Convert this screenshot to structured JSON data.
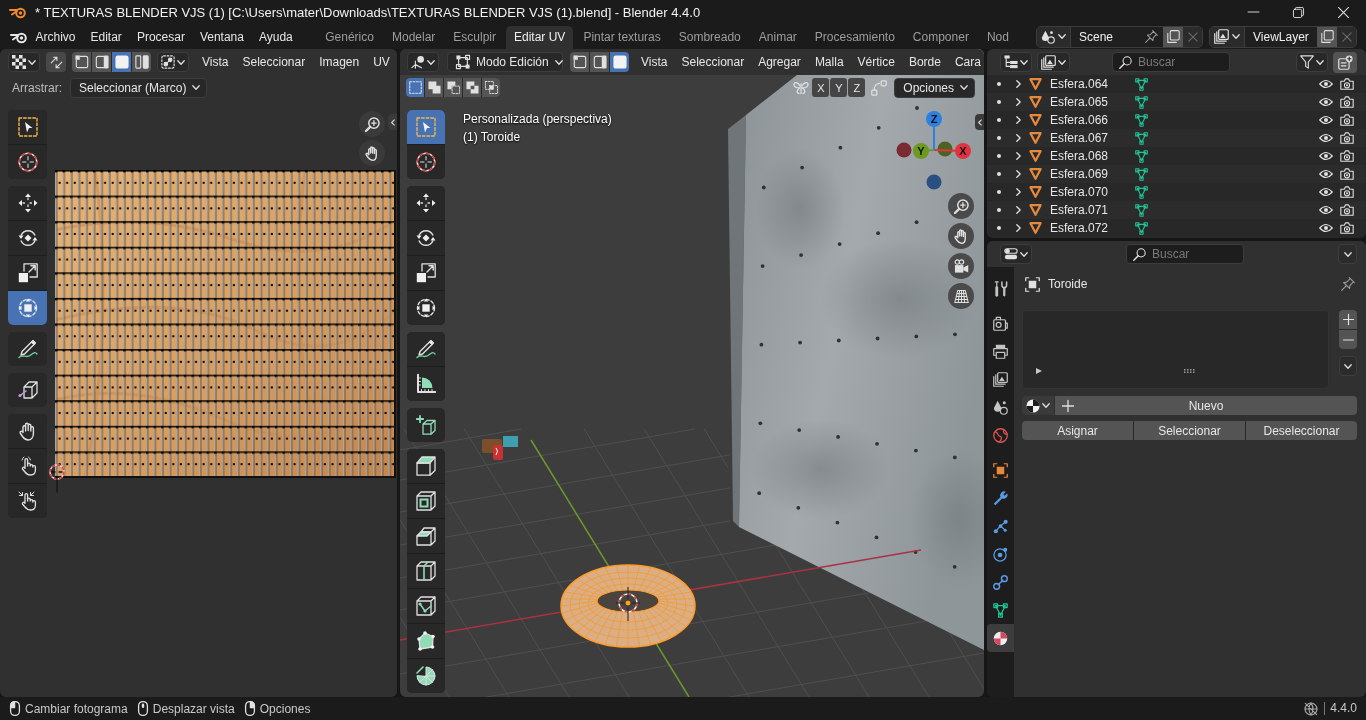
{
  "window": {
    "title": "* TEXTURAS BLENDER VJS (1) [C:\\Users\\mater\\Downloads\\TEXTURAS BLENDER VJS (1).blend] - Blender 4.4.0"
  },
  "menu": [
    "Archivo",
    "Editar",
    "Procesar",
    "Ventana",
    "Ayuda"
  ],
  "workspaces": [
    {
      "label": "Genérico",
      "selected": false
    },
    {
      "label": "Modelar",
      "selected": false
    },
    {
      "label": "Esculpir",
      "selected": false
    },
    {
      "label": "Editar UV",
      "selected": true
    },
    {
      "label": "Pintar texturas",
      "selected": false
    },
    {
      "label": "Sombreado",
      "selected": false
    },
    {
      "label": "Animar",
      "selected": false
    },
    {
      "label": "Procesamiento",
      "selected": false
    },
    {
      "label": "Componer",
      "selected": false
    },
    {
      "label": "Nod",
      "selected": false
    }
  ],
  "scene": {
    "value": "Scene"
  },
  "view_layer": {
    "value": "ViewLayer"
  },
  "uv_editor": {
    "select_modes": [
      {
        "kind": "vertex",
        "selected": false
      },
      {
        "kind": "edge",
        "selected": false
      },
      {
        "kind": "face",
        "selected": true
      },
      {
        "kind": "island",
        "selected": false
      }
    ],
    "menus": [
      "Vista",
      "Seleccionar",
      "Imagen",
      "UV"
    ],
    "drag": {
      "label": "Arrastrar:",
      "value": "Seleccionar (Marco)"
    },
    "tool_groups": [
      {
        "tools": [
          {
            "kind": "select",
            "selected": false
          },
          {
            "kind": "cursor",
            "selected": false
          }
        ]
      },
      {
        "tools": [
          {
            "kind": "move",
            "selected": false
          },
          {
            "kind": "rotate",
            "selected": false
          },
          {
            "kind": "scale",
            "selected": false
          },
          {
            "kind": "transform",
            "selected": true
          }
        ]
      },
      {
        "tools": [
          {
            "kind": "annotate",
            "selected": false
          }
        ]
      },
      {
        "tools": [
          {
            "kind": "rip",
            "selected": false
          }
        ]
      },
      {
        "tools": [
          {
            "kind": "grab",
            "selected": false
          },
          {
            "kind": "relax",
            "selected": false
          },
          {
            "kind": "pinch",
            "selected": false
          }
        ]
      }
    ]
  },
  "viewport": {
    "mode": "Modo Edición",
    "select_modes": [
      {
        "kind": "vertex",
        "selected": false
      },
      {
        "kind": "edge",
        "selected": false
      },
      {
        "kind": "face",
        "selected": true
      }
    ],
    "menus": [
      "Vista",
      "Seleccionar",
      "Agregar",
      "Malla",
      "Vértice",
      "Borde",
      "Cara"
    ],
    "box_modes": [
      {
        "kind": "set",
        "selected": true
      },
      {
        "kind": "extend",
        "selected": false
      },
      {
        "kind": "subtract",
        "selected": false
      },
      {
        "kind": "difference",
        "selected": false
      },
      {
        "kind": "intersect",
        "selected": false
      }
    ],
    "axis_toggles": [
      "X",
      "Y",
      "Z"
    ],
    "options": "Opciones",
    "view_info": [
      "Personalizada (perspectiva)",
      "(1) Toroide"
    ],
    "gizmo_axes": [
      "X",
      "Y",
      "Z"
    ],
    "tool_groups": [
      {
        "tools": [
          {
            "kind": "select",
            "selected": true
          },
          {
            "kind": "cursor",
            "selected": false
          }
        ]
      },
      {
        "tools": [
          {
            "kind": "move",
            "selected": false
          },
          {
            "kind": "rotate",
            "selected": false
          },
          {
            "kind": "scale",
            "selected": false
          },
          {
            "kind": "transform",
            "selected": false
          }
        ]
      },
      {
        "tools": [
          {
            "kind": "annotate",
            "selected": false
          },
          {
            "kind": "measure",
            "selected": false
          }
        ]
      },
      {
        "tools": [
          {
            "kind": "add",
            "selected": false
          }
        ]
      },
      {
        "tools": [
          {
            "kind": "extrude",
            "selected": false
          },
          {
            "kind": "inset",
            "selected": false
          },
          {
            "kind": "bevel",
            "selected": false
          },
          {
            "kind": "loopcut",
            "selected": false
          },
          {
            "kind": "knife",
            "selected": false
          },
          {
            "kind": "polybuild",
            "selected": false
          },
          {
            "kind": "spin",
            "selected": false
          }
        ]
      }
    ]
  },
  "outliner": {
    "search": {
      "placeholder": "Buscar"
    },
    "rows": [
      {
        "name": "Esfera.064"
      },
      {
        "name": "Esfera.065"
      },
      {
        "name": "Esfera.066"
      },
      {
        "name": "Esfera.067"
      },
      {
        "name": "Esfera.068"
      },
      {
        "name": "Esfera.069"
      },
      {
        "name": "Esfera.070"
      },
      {
        "name": "Esfera.071"
      },
      {
        "name": "Esfera.072"
      }
    ]
  },
  "properties": {
    "search": {
      "placeholder": "Buscar"
    },
    "tab_groups": [
      {
        "tabs": [
          {
            "kind": "tool",
            "selected": false
          }
        ]
      },
      {
        "tabs": [
          {
            "kind": "render",
            "selected": false
          },
          {
            "kind": "output",
            "selected": false
          },
          {
            "kind": "view_layer",
            "selected": false
          },
          {
            "kind": "scene",
            "selected": false
          },
          {
            "kind": "world",
            "selected": false
          }
        ]
      },
      {
        "tabs": [
          {
            "kind": "object",
            "selected": false
          },
          {
            "kind": "modifiers",
            "selected": false
          },
          {
            "kind": "particles",
            "selected": false
          },
          {
            "kind": "physics",
            "selected": false
          },
          {
            "kind": "constraints",
            "selected": false
          },
          {
            "kind": "data",
            "selected": false
          },
          {
            "kind": "material",
            "selected": true
          }
        ]
      }
    ],
    "object_name": "Toroide",
    "new_button": "Nuevo",
    "buttons": [
      "Asignar",
      "Seleccionar",
      "Deseleccionar"
    ]
  },
  "status_bar": {
    "hints": [
      {
        "kind": "left",
        "label": "Cambiar fotograma"
      },
      {
        "kind": "middle",
        "label": "Desplazar vista"
      },
      {
        "kind": "right",
        "label": "Opciones"
      }
    ],
    "version": "4.4.0"
  }
}
